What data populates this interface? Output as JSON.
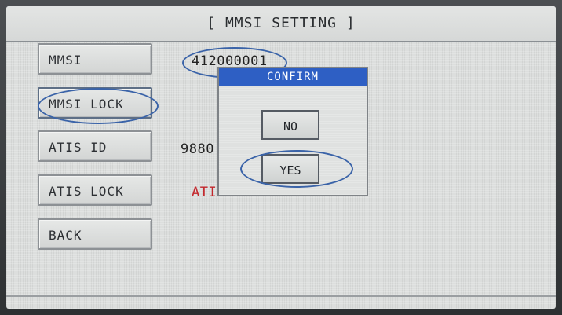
{
  "header": {
    "title": "[ MMSI SETTING ]"
  },
  "menu": {
    "items": [
      {
        "label": "MMSI"
      },
      {
        "label": "MMSI LOCK"
      },
      {
        "label": "ATIS ID"
      },
      {
        "label": "ATIS LOCK"
      },
      {
        "label": "BACK"
      }
    ]
  },
  "values": {
    "mmsi": "412000001",
    "atis_id": "9880",
    "atis_lock": "ATI"
  },
  "dialog": {
    "title": "CONFIRM",
    "no_label": "NO",
    "yes_label": "YES"
  },
  "colors": {
    "dialog_header": "#2e5fc4",
    "atis_lock_text": "#c3262b",
    "highlight_ellipse": "#3a63a8"
  }
}
